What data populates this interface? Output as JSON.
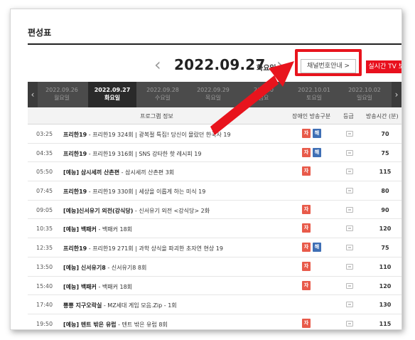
{
  "section_title": "편성표",
  "date": {
    "prev_icon": "chevron-left-icon",
    "next_icon": "chevron-right-icon",
    "current": "2022.09.27",
    "weekday": "화요일"
  },
  "buttons": {
    "channel_info": "채널번호안내 >",
    "live_tv": "실시간 TV 보기 >"
  },
  "tabs": [
    {
      "date": "2022.09.26",
      "day": "월요일"
    },
    {
      "date": "2022.09.27",
      "day": "화요일",
      "active": true
    },
    {
      "date": "2022.09.28",
      "day": "수요일"
    },
    {
      "date": "2022.09.29",
      "day": "목요일"
    },
    {
      "date": "2022.0",
      "day": "금요"
    },
    {
      "date": "2022.10.01",
      "day": "토요일"
    },
    {
      "date": "2022.10.02",
      "day": "일요일"
    }
  ],
  "table": {
    "headers": [
      "프로그램 정보",
      "장애인 방송구분",
      "등급",
      "방송시간 (분)"
    ],
    "rows": [
      {
        "time": "03:25",
        "show": "프리한19",
        "desc": " - 프리한19 324회 | 광복절 특집! 당신이 몰랐던 한국사 19",
        "badges": [
          "자",
          "해"
        ],
        "dur": "70"
      },
      {
        "time": "04:35",
        "show": "프리한19",
        "desc": " - 프리한19 316회 | SNS 강타한 핫 레시피 19",
        "badges": [
          "자",
          "해"
        ],
        "dur": "75"
      },
      {
        "time": "05:50",
        "show": "[예능] 삼시세끼 산촌편",
        "desc": " - 삼시세끼 산촌편 3회",
        "badges": [
          "자"
        ],
        "dur": "115"
      },
      {
        "time": "07:45",
        "show": "프리한19",
        "desc": " - 프리한19 330회 | 세상을 이롭게 하는 미식 19",
        "badges": [],
        "dur": "80"
      },
      {
        "time": "09:05",
        "show": "[예능]신서유기 외전(강식당)",
        "desc": " - 신서유기 외전 <강식당> 2화",
        "badges": [
          "자"
        ],
        "dur": "90"
      },
      {
        "time": "10:35",
        "show": "[예능] 백패커",
        "desc": " - 백패커 18회",
        "badges": [
          "자"
        ],
        "dur": "120"
      },
      {
        "time": "12:35",
        "show": "프리한19",
        "desc": " - 프리한19 271회 | 과학 상식을 파괴한 초자연 현상 19",
        "badges": [
          "자",
          "해"
        ],
        "dur": "75"
      },
      {
        "time": "13:50",
        "show": "[예능] 신서유기8",
        "desc": " - 신서유기8 8회",
        "badges": [
          "자"
        ],
        "dur": "110"
      },
      {
        "time": "15:40",
        "show": "[예능] 백패커",
        "desc": " - 백패커 18회",
        "badges": [
          "자"
        ],
        "dur": "120"
      },
      {
        "time": "17:40",
        "show": "뿅뿅 지구오락실",
        "desc": " - MZ세대 게임 모음.Zip - 1회",
        "badges": [],
        "dur": "130"
      },
      {
        "time": "19:50",
        "show": "[예능] 텐트 밖은 유럽",
        "desc": " - 텐트 밖은 유럽 8회",
        "badges": [
          "자"
        ],
        "dur": "115"
      }
    ]
  },
  "colors": {
    "accent_red": "#e8101e",
    "badge_red": "#e85a4a",
    "badge_blue": "#3f6fb5",
    "tab_bar": "#4b4b4b"
  }
}
